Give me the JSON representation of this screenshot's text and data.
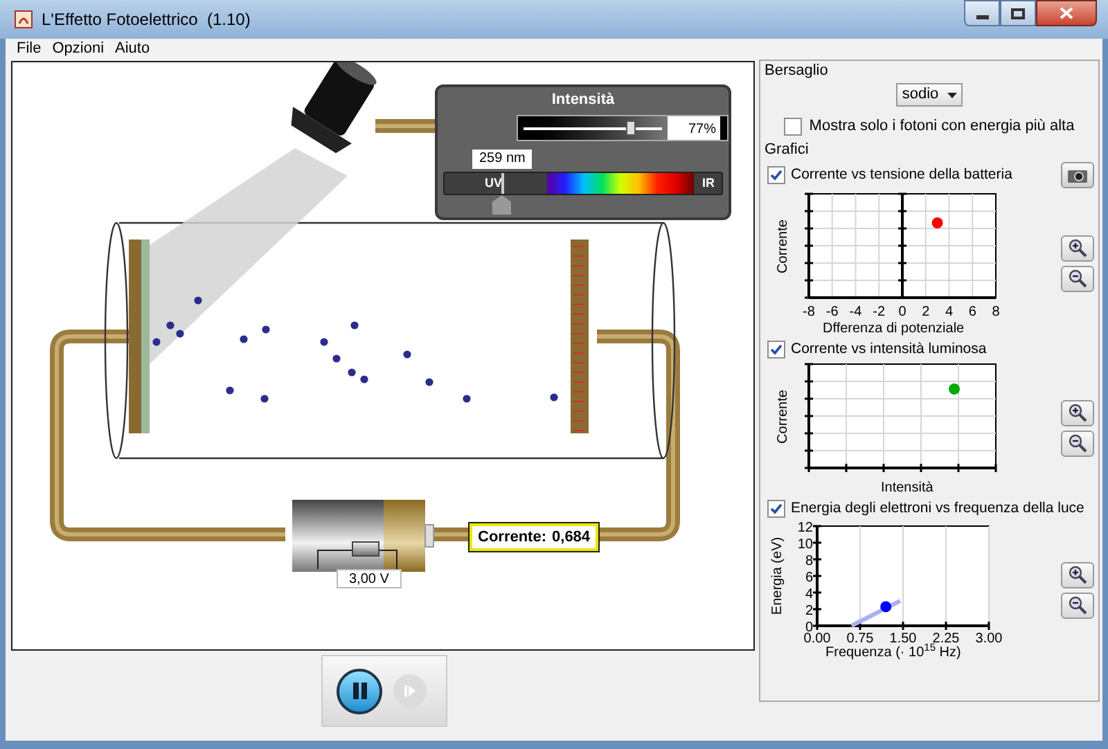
{
  "window": {
    "title": "L'Effetto Fotoelettrico  (1.10)"
  },
  "menu": [
    "File",
    "Opzioni",
    "Aiuto"
  ],
  "intensity_panel": {
    "title": "Intensità",
    "level": 0.77,
    "reading": "77%"
  },
  "wavelength": {
    "reading": "259 nm",
    "level": 0.21,
    "uv_label": "UV",
    "ir_label": "IR"
  },
  "battery": {
    "voltage": "3,00 V",
    "level": 0.6
  },
  "current_meter": {
    "label": "Corrente:",
    "value": "0,684"
  },
  "playback": {
    "running": true,
    "step_enabled": false
  },
  "right_panel": {
    "target": {
      "heading": "Bersaglio",
      "value": "sodio"
    },
    "highest_energy_only": {
      "label": "Mostra solo i fotoni con energia più alta",
      "checked": false
    },
    "graphs_heading": "Grafici",
    "graphs": [
      {
        "kind": "voltage",
        "label": "Corrente vs tensione della batteria",
        "checked": true,
        "ylabel": "Corrente",
        "xlabel": "Dfferenza di potenziale",
        "x_tick_labels": [
          "-8",
          "-6",
          "-4",
          "-2",
          "0",
          "2",
          "4",
          "6",
          "8"
        ],
        "color": "#ff0000"
      },
      {
        "kind": "intensity",
        "label": "Corrente vs intensità luminosa",
        "checked": true,
        "ylabel": "Corrente",
        "xlabel": "Intensità",
        "color": "#00aa00"
      },
      {
        "kind": "energy",
        "label": "Energia degli elettroni vs frequenza della luce",
        "checked": true,
        "chart_data": {
          "type": "scatter",
          "xlabel": "Frequenza (· 10$^{15}$ Hz)",
          "ylabel": "Energia (eV)",
          "x": [
            1.2
          ],
          "grid": true,
          "xlim": [
            0,
            3
          ],
          "ylim": [
            0,
            12
          ],
          "xticks": [
            {
              "value": 0,
              "label": "0.00"
            },
            {
              "value": 0.75,
              "label": "0.75"
            },
            {
              "value": 1.5,
              "label": "1.50"
            },
            {
              "value": 2.25,
              "label": "2.25"
            },
            {
              "value": 3,
              "label": "3.00"
            }
          ],
          "yticks": [
            0,
            2,
            4,
            6,
            8,
            10,
            12
          ],
          "series": [
            {
              "color": "#0000ff",
              "values": [
                2.3
              ]
            }
          ]
        }
      }
    ]
  }
}
